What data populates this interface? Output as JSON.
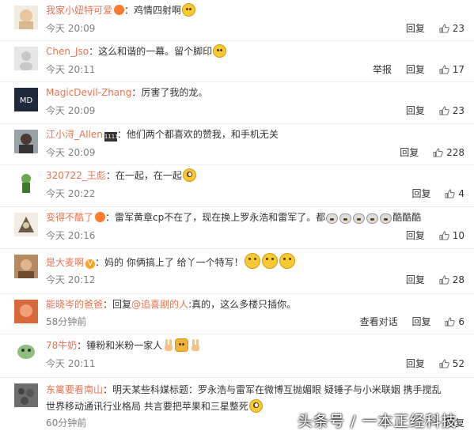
{
  "comments": [
    {
      "user": "我家小妞特可爱",
      "text": "鸡情四射啊",
      "time": "今天 20:09",
      "reply": "回复",
      "likes": "23"
    },
    {
      "user": "Chen_Jso",
      "text": "这么和谐的一幕。留个脚印",
      "time": "今天 20:11",
      "report": "举报",
      "reply": "回复",
      "likes": "17"
    },
    {
      "user": "MagicDevil-Zhang",
      "text": "厉害了我的龙。",
      "time": "今天 20:09",
      "reply": "回复",
      "likes": "23"
    },
    {
      "user": "江小浔_Allen",
      "badge": "1111",
      "text": "他们两个都喜欢的赞我，和手机无关",
      "time": "今天 20:09",
      "reply": "回复",
      "likes": "228"
    },
    {
      "user": "320722_王彪",
      "text": "在一起，在一起",
      "time": "今天 20:22",
      "reply": "回复",
      "likes": "4"
    },
    {
      "user": "变得不酷了",
      "text": "雷军黄章cp不在了，现在换上罗永浩和雷军了。都",
      "text2": "酷酷酷",
      "time": "今天 20:16",
      "reply": "回复",
      "likes": "10"
    },
    {
      "user": "是大麦啊",
      "text": "妈的 你俩搞上了 给丫一个特写！",
      "time": "今天 20:12",
      "reply": "回复",
      "likes": "28"
    },
    {
      "user": "能晓岑的爸爸",
      "reply_prefix": "回复",
      "at": "@追喜剧的人",
      "text": "真的，这么多楼只插你。",
      "time": "58分钟前",
      "view": "查看对话",
      "reply": "回复",
      "likes": "6"
    },
    {
      "user": "78牛奶",
      "text": "锤粉和米粉一家人",
      "time": "今天 20:11",
      "reply": "回复",
      "likes": "52"
    },
    {
      "user": "东篱要看南山",
      "text": "明天某些科媒标题：罗永浩与雷军在微博互抛媚眼 疑锤子与小米联姻 携手搅乱",
      "text2": "世界移动通讯行业格局 共言要把苹果和三星整死",
      "time": "60分钟前",
      "reply": "回复"
    }
  ],
  "watermark": "头条号 / 一本正经科技"
}
